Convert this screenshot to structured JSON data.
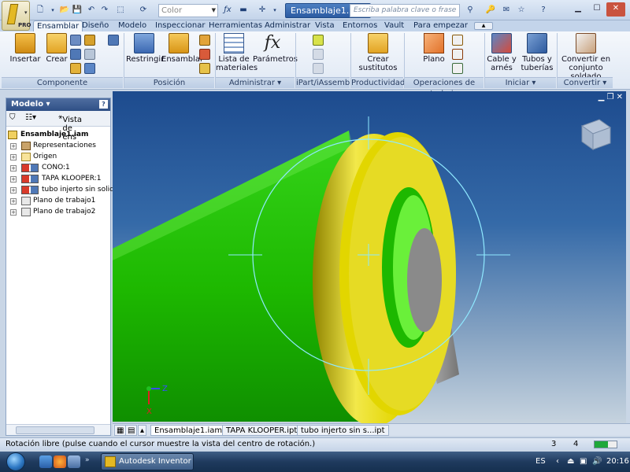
{
  "app": {
    "badge": "PRO",
    "document_title": "Ensamblaje1.iam",
    "color_placeholder": "Color",
    "search_placeholder": "Escriba palabra clave o frase"
  },
  "tabs": [
    "Ensamblar",
    "Diseño",
    "Modelo",
    "Inspeccionar",
    "Herramientas",
    "Administrar",
    "Vista",
    "Entornos",
    "Vault",
    "Para empezar"
  ],
  "ribbon": {
    "componente": {
      "label": "Componente",
      "insertar": "Insertar",
      "crear": "Crear"
    },
    "posicion": {
      "label": "Posición",
      "restringir": "Restringir",
      "ensamblar": "Ensamblar"
    },
    "administrar": {
      "label": "Administrar",
      "lista_1": "Lista de",
      "lista_2": "materiales",
      "parametros": "Parámetros"
    },
    "ipart": {
      "label": "iPart/iAssembly"
    },
    "productividad": {
      "label": "Productividad",
      "crear_1": "Crear",
      "crear_2": "sustitutos"
    },
    "operaciones": {
      "label": "Operaciones de trabajo",
      "plano": "Plano"
    },
    "iniciar": {
      "label": "Iniciar",
      "cable_1": "Cable y",
      "cable_2": "arnés",
      "tubos_1": "Tubos y",
      "tubos_2": "tuberías"
    },
    "convertir": {
      "label": "Convertir",
      "conv_1": "Convertir en",
      "conv_2": "conjunto soldado"
    }
  },
  "browser": {
    "title": "Modelo",
    "vista": "Vista de ens",
    "help": "?",
    "root": "Ensamblaje1.iam",
    "items": [
      "Representaciones",
      "Origen",
      "CONO:1",
      "TAPA KLOOPER:1",
      "tubo injerto  sin solidos",
      "Plano de trabajo1",
      "Plano de trabajo2"
    ]
  },
  "viewport": {
    "axis_z": "Z",
    "axis_x": "X",
    "colors": {
      "cone": "#1db800",
      "cap": "#e2d600",
      "pipe": "#8a8a8a",
      "circle": "#8fe9ff"
    }
  },
  "doc_tabs": [
    "Ensamblaje1.iam",
    "TAPA KLOOPER.ipt",
    "tubo injerto  sin s...ipt"
  ],
  "status": {
    "text": "Rotación libre (pulse cuando el cursor muestre la vista del centro de rotación.)",
    "n1": "3",
    "n2": "4",
    "progress": 0.6
  },
  "taskbar": {
    "task_label": "Autodesk Inventor P...",
    "lang": "ES",
    "time": "20:16"
  }
}
